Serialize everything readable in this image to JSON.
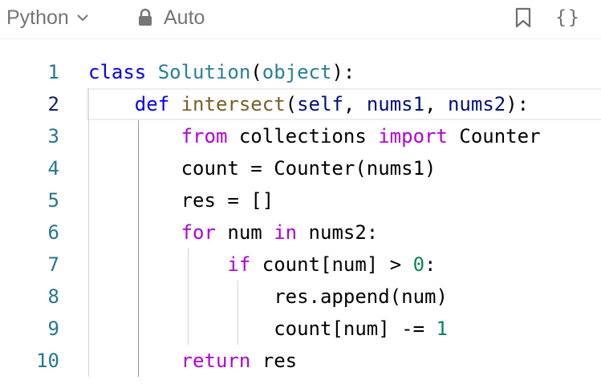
{
  "toolbar": {
    "language": "Python",
    "mode": "Auto",
    "icons": [
      "chevron-down-icon",
      "lock-icon",
      "bookmark-icon",
      "braces-icon"
    ],
    "braces_glyph": "{}"
  },
  "editor": {
    "active_line": 2,
    "lines": [
      {
        "number": "1",
        "tokens": [
          {
            "t": "class",
            "c": "kw"
          },
          {
            "t": " ",
            "c": ""
          },
          {
            "t": "Solution",
            "c": "cls"
          },
          {
            "t": "(",
            "c": ""
          },
          {
            "t": "object",
            "c": "cls"
          },
          {
            "t": "):",
            "c": ""
          }
        ]
      },
      {
        "number": "2",
        "tokens": [
          {
            "t": "    ",
            "c": ""
          },
          {
            "t": "def",
            "c": "kw"
          },
          {
            "t": " ",
            "c": ""
          },
          {
            "t": "intersect",
            "c": "fn"
          },
          {
            "t": "(",
            "c": ""
          },
          {
            "t": "self",
            "c": "prm"
          },
          {
            "t": ", ",
            "c": ""
          },
          {
            "t": "nums1",
            "c": "prm"
          },
          {
            "t": ", ",
            "c": ""
          },
          {
            "t": "nums2",
            "c": "prm"
          },
          {
            "t": "):",
            "c": ""
          }
        ]
      },
      {
        "number": "3",
        "tokens": [
          {
            "t": "        ",
            "c": ""
          },
          {
            "t": "from",
            "c": "kw2"
          },
          {
            "t": " collections ",
            "c": ""
          },
          {
            "t": "import",
            "c": "kw2"
          },
          {
            "t": " Counter",
            "c": ""
          }
        ]
      },
      {
        "number": "4",
        "tokens": [
          {
            "t": "        count = Counter(nums1)",
            "c": ""
          }
        ]
      },
      {
        "number": "5",
        "tokens": [
          {
            "t": "        res = []",
            "c": ""
          }
        ]
      },
      {
        "number": "6",
        "tokens": [
          {
            "t": "        ",
            "c": ""
          },
          {
            "t": "for",
            "c": "kw2"
          },
          {
            "t": " num ",
            "c": ""
          },
          {
            "t": "in",
            "c": "kw2"
          },
          {
            "t": " nums2:",
            "c": ""
          }
        ]
      },
      {
        "number": "7",
        "tokens": [
          {
            "t": "            ",
            "c": ""
          },
          {
            "t": "if",
            "c": "kw2"
          },
          {
            "t": " count[num] > ",
            "c": ""
          },
          {
            "t": "0",
            "c": "num"
          },
          {
            "t": ":",
            "c": ""
          }
        ]
      },
      {
        "number": "8",
        "tokens": [
          {
            "t": "                res.append(num)",
            "c": ""
          }
        ]
      },
      {
        "number": "9",
        "tokens": [
          {
            "t": "                count[num] -= ",
            "c": ""
          },
          {
            "t": "1",
            "c": "num"
          }
        ]
      },
      {
        "number": "10",
        "tokens": [
          {
            "t": "        ",
            "c": ""
          },
          {
            "t": "return",
            "c": "kw2"
          },
          {
            "t": " res",
            "c": ""
          }
        ]
      }
    ]
  }
}
